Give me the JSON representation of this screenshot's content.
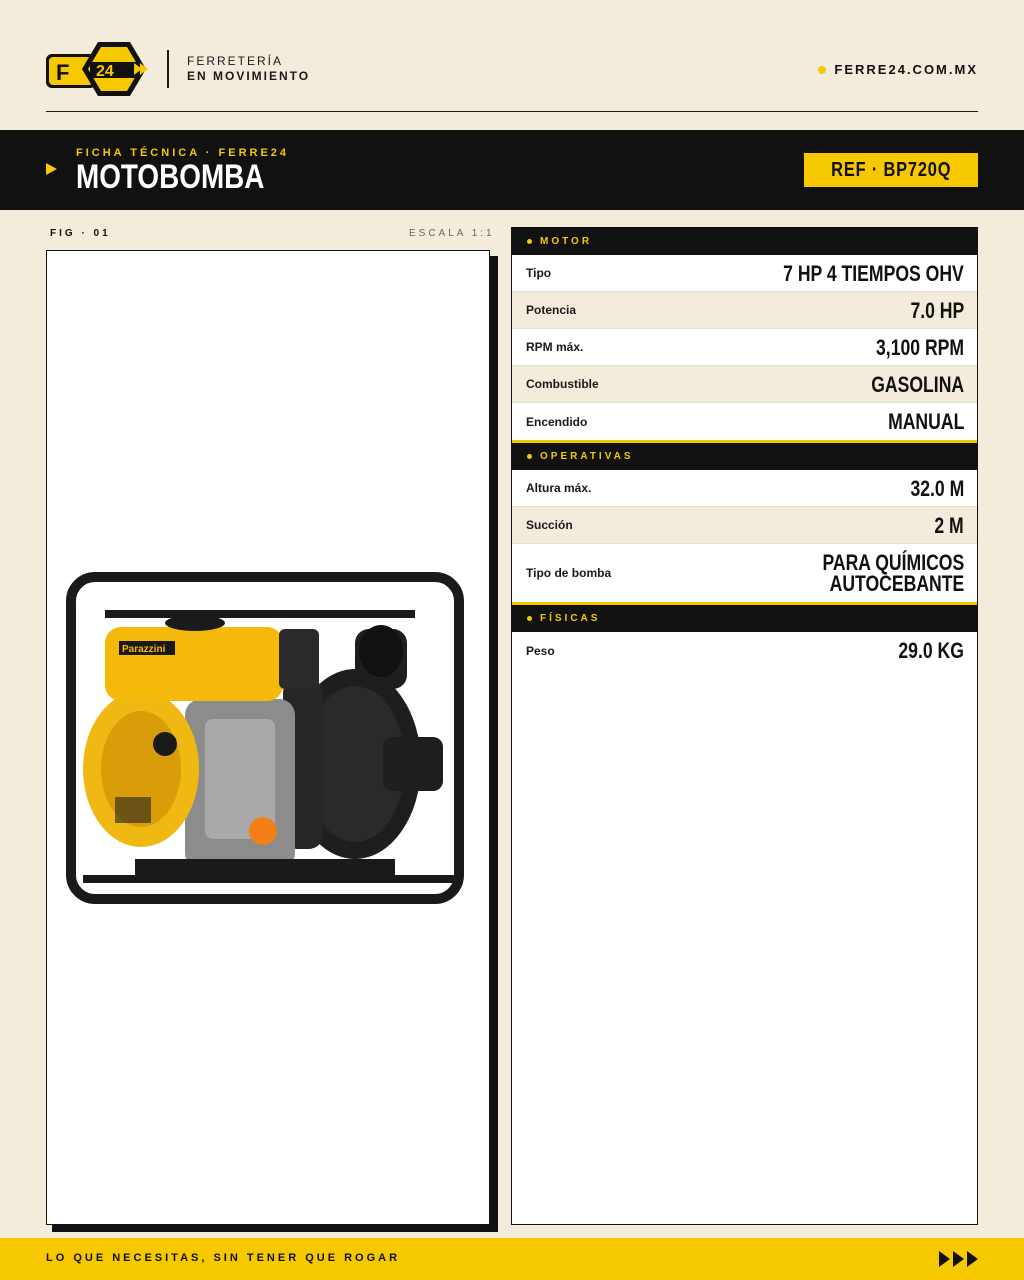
{
  "header": {
    "logo_text": "24",
    "logo_letter": "F",
    "tagline_line1": "FERRETERÍA",
    "tagline_line2": "EN MOVIMIENTO",
    "site_url": "FERRE24.COM.MX"
  },
  "title_bar": {
    "kicker": "FICHA TÉCNICA · FERRE24",
    "product": "MOTOBOMBA",
    "ref": "REF · BP720Q"
  },
  "figure": {
    "label": "FIG · 01",
    "scale": "ESCALA 1:1",
    "image_alt": "motobomba-image",
    "brand": "Parazzini"
  },
  "specs": {
    "sections": [
      {
        "title": "MOTOR",
        "rows": [
          {
            "label": "Tipo",
            "value": "7 HP 4 TIEMPOS OHV"
          },
          {
            "label": "Potencia",
            "value": "7.0 HP"
          },
          {
            "label": "RPM máx.",
            "value": "3,100 RPM"
          },
          {
            "label": "Combustible",
            "value": "GASOLINA"
          },
          {
            "label": "Encendido",
            "value": "MANUAL"
          }
        ]
      },
      {
        "title": "OPERATIVAS",
        "rows": [
          {
            "label": "Altura máx.",
            "value": "32.0 M"
          },
          {
            "label": "Succión",
            "value": "2 M"
          },
          {
            "label": "Tipo de bomba",
            "value": "PARA QUÍMICOS",
            "value2": "AUTOCEBANTE"
          }
        ]
      },
      {
        "title": "FÍSICAS",
        "rows": [
          {
            "label": "Peso",
            "value": "29.0 KG"
          }
        ]
      }
    ]
  },
  "footer": {
    "slogan": "LO QUE NECESITAS, SIN TENER QUE ROGAR",
    "arrows_icon": "triple-play-arrows-icon"
  },
  "colors": {
    "background": "#f3ecdc",
    "accent": "#f5c800",
    "dark": "#111111"
  }
}
